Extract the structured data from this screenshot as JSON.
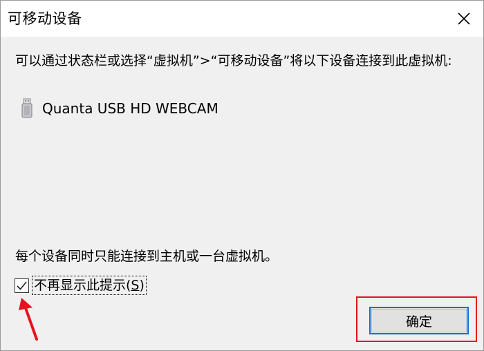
{
  "window": {
    "title": "可移动设备",
    "close_icon": "close-icon"
  },
  "body": {
    "message": "可以通过状态栏或选择“虚拟机”>“可移动设备”将以下设备连接到此虚拟机:",
    "device": {
      "icon": "usb-drive-icon",
      "name": "Quanta USB HD WEBCAM"
    },
    "note": "每个设备同时只能连接到主机或一台虚拟机。",
    "checkbox": {
      "label_prefix": "不再显示此提示(",
      "label_accel": "S",
      "label_suffix": ")",
      "checked": true
    }
  },
  "footer": {
    "ok_label": "确定"
  },
  "annotations": {
    "arrow_color": "#e8111e",
    "highlight_color": "#e8111e"
  }
}
